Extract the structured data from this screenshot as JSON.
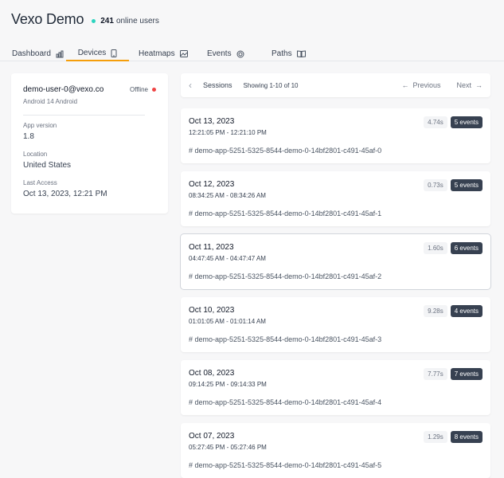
{
  "header": {
    "title": "Vexo Demo",
    "online_count": "241",
    "online_label": "online users"
  },
  "tabs": [
    {
      "label": "Dashboard",
      "icon": "bar-chart-icon"
    },
    {
      "label": "Devices",
      "icon": "phone-icon"
    },
    {
      "label": "Heatmaps",
      "icon": "image-icon"
    },
    {
      "label": "Events",
      "icon": "target-icon"
    },
    {
      "label": "Paths",
      "icon": "book-icon"
    }
  ],
  "device": {
    "email": "demo-user-0@vexo.co",
    "os": "Android 14 Android",
    "status": "Offline",
    "app_version_label": "App version",
    "app_version": "1.8",
    "location_label": "Location",
    "location": "United States",
    "last_access_label": "Last Access",
    "last_access": "Oct 13, 2023, 12:21 PM"
  },
  "sessions_bar": {
    "title": "Sessions",
    "showing": "Showing 1-10 of 10",
    "previous": "Previous",
    "next": "Next"
  },
  "sessions": [
    {
      "date": "Oct 13, 2023",
      "time": "12:21:05 PM - 12:21:10 PM",
      "duration": "4.74s",
      "events": "5 events",
      "id": "# demo-app-5251-5325-8544-demo-0-14bf2801-c491-45af-0"
    },
    {
      "date": "Oct 12, 2023",
      "time": "08:34:25 AM - 08:34:26 AM",
      "duration": "0.73s",
      "events": "5 events",
      "id": "# demo-app-5251-5325-8544-demo-0-14bf2801-c491-45af-1"
    },
    {
      "date": "Oct 11, 2023",
      "time": "04:47:45 AM - 04:47:47 AM",
      "duration": "1.60s",
      "events": "6 events",
      "id": "# demo-app-5251-5325-8544-demo-0-14bf2801-c491-45af-2"
    },
    {
      "date": "Oct 10, 2023",
      "time": "01:01:05 AM - 01:01:14 AM",
      "duration": "9.28s",
      "events": "4 events",
      "id": "# demo-app-5251-5325-8544-demo-0-14bf2801-c491-45af-3"
    },
    {
      "date": "Oct 08, 2023",
      "time": "09:14:25 PM - 09:14:33 PM",
      "duration": "7.77s",
      "events": "7 events",
      "id": "# demo-app-5251-5325-8544-demo-0-14bf2801-c491-45af-4"
    },
    {
      "date": "Oct 07, 2023",
      "time": "05:27:45 PM - 05:27:46 PM",
      "duration": "1.29s",
      "events": "8 events",
      "id": "# demo-app-5251-5325-8544-demo-0-14bf2801-c491-45af-5"
    }
  ]
}
